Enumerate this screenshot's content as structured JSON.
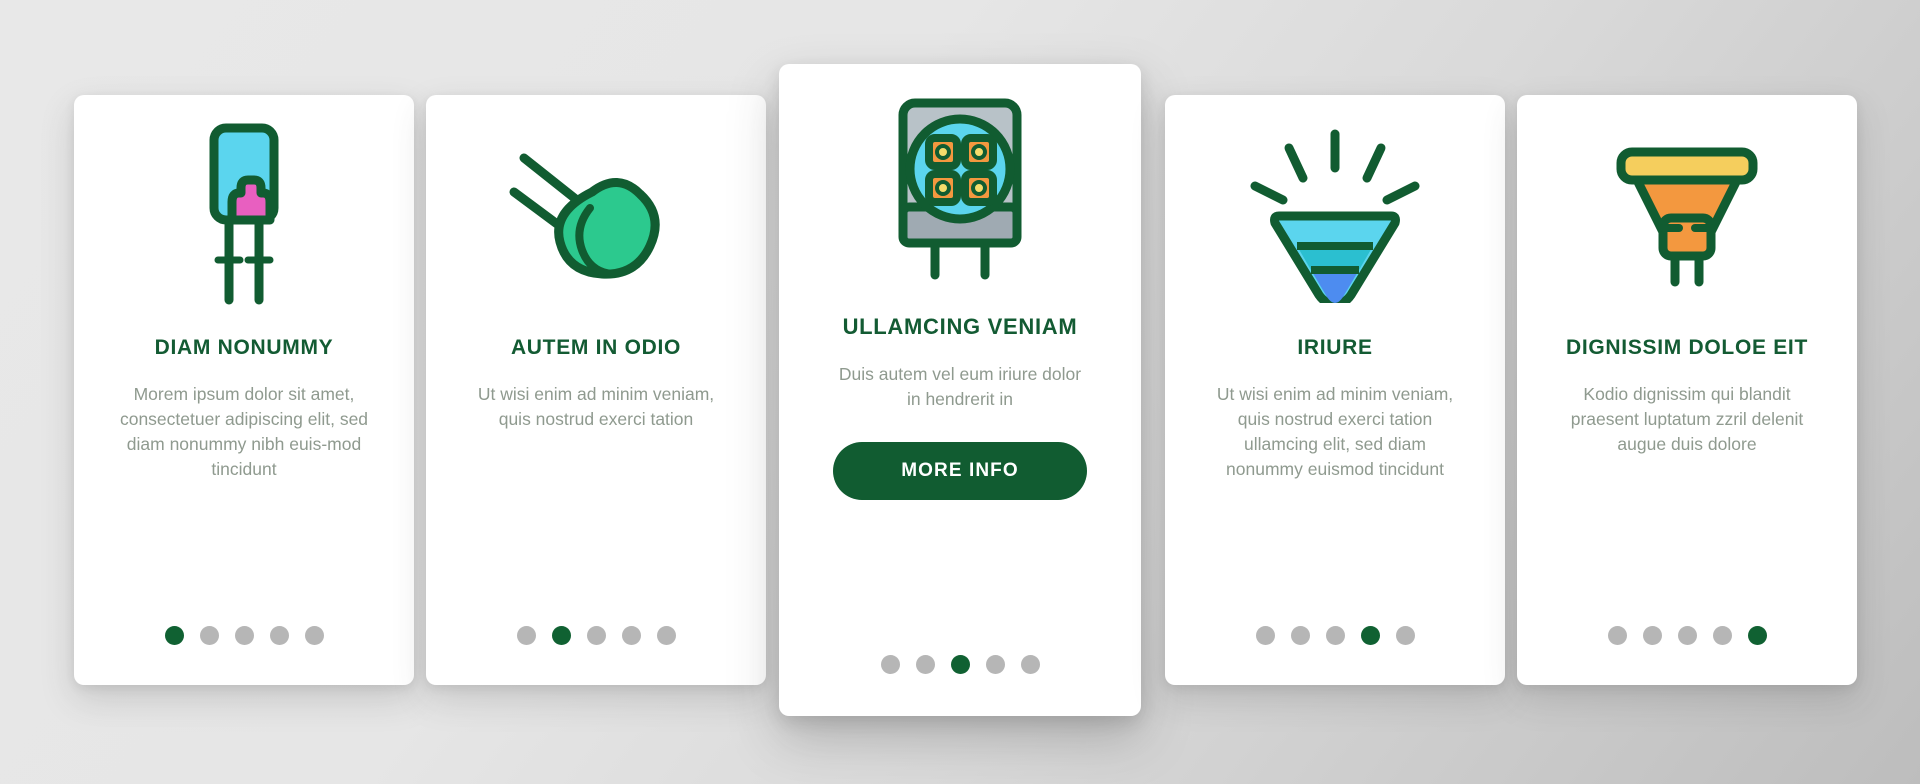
{
  "theme": {
    "accent_green": "#115c31",
    "title_green": "#135b33",
    "body_gray": "#8f9a8f",
    "dot_inactive": "#b6b6b6",
    "dot_active": "#106132",
    "card_bg": "#ffffff",
    "icon_cyan": "#5BD5EE",
    "icon_pink": "#E85FC0",
    "icon_mint": "#2CC98E",
    "icon_gray": "#B8C2C8",
    "icon_orange": "#F3983F",
    "icon_yellow": "#F5CE5D",
    "icon_blue": "#4D8CF0",
    "icon_teal": "#2BBFD0"
  },
  "cards": [
    {
      "id": "card-1",
      "icon": "led-through-hole-icon",
      "title": "DIAM NONUMMY",
      "body": "Morem ipsum dolor sit amet, consectetuer adipiscing elit, sed diam nonummy nibh euis-mod tincidunt",
      "dots": {
        "count": 5,
        "active_index": 0
      },
      "has_button": false,
      "elevated": false
    },
    {
      "id": "card-2",
      "icon": "led-diode-tilted-icon",
      "title": "AUTEM IN ODIO",
      "body": "Ut wisi enim ad minim veniam, quis nostrud exerci tation",
      "dots": {
        "count": 5,
        "active_index": 1
      },
      "has_button": false,
      "elevated": false
    },
    {
      "id": "card-3",
      "icon": "led-panel-module-icon",
      "title": "ULLAMCING VENIAM",
      "body": "Duis autem vel eum iriure dolor in hendrerit in",
      "button_label": "MORE INFO",
      "dots": {
        "count": 5,
        "active_index": 2
      },
      "has_button": true,
      "elevated": true
    },
    {
      "id": "card-4",
      "icon": "shining-lamp-icon",
      "title": "IRIURE",
      "body": "Ut wisi enim ad minim veniam, quis nostrud exerci tation ullamcing elit, sed diam nonummy euismod tincidunt",
      "dots": {
        "count": 5,
        "active_index": 3
      },
      "has_button": false,
      "elevated": false
    },
    {
      "id": "card-5",
      "icon": "halogen-mr16-bulb-icon",
      "title": "DIGNISSIM DOLOE EIT",
      "body": "Kodio dignissim qui blandit praesent luptatum zzril delenit augue duis dolore",
      "dots": {
        "count": 5,
        "active_index": 4
      },
      "has_button": false,
      "elevated": false
    }
  ]
}
